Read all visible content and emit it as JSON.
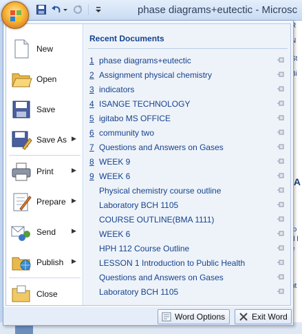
{
  "window": {
    "title": "phase diagrams+eutectic - Microsc"
  },
  "commands": [
    {
      "label": "New",
      "icon": "new-document-icon",
      "arrow": ""
    },
    {
      "label": "Open",
      "icon": "open-folder-icon",
      "arrow": ""
    },
    {
      "label": "Save",
      "icon": "save-disk-icon",
      "arrow": ""
    },
    {
      "label": "Save As",
      "icon": "save-as-icon",
      "arrow": "▶"
    },
    {
      "label": "Print",
      "icon": "printer-icon",
      "arrow": "▶"
    },
    {
      "label": "Prepare",
      "icon": "prepare-icon",
      "arrow": "▶"
    },
    {
      "label": "Send",
      "icon": "send-icon",
      "arrow": "▶"
    },
    {
      "label": "Publish",
      "icon": "publish-icon",
      "arrow": "▶"
    },
    {
      "label": "Close",
      "icon": "close-folder-icon",
      "arrow": ""
    }
  ],
  "recent": {
    "title": "Recent Documents",
    "items": [
      {
        "num": "1",
        "name": "phase diagrams+eutectic"
      },
      {
        "num": "2",
        "name": "Assignment physical chemistry"
      },
      {
        "num": "3",
        "name": "indicators"
      },
      {
        "num": "4",
        "name": "ISANGE TECHNOLOGY"
      },
      {
        "num": "5",
        "name": "igitabo MS OFFICE"
      },
      {
        "num": "6",
        "name": "community two"
      },
      {
        "num": "7",
        "name": "Questions and Answers on Gases"
      },
      {
        "num": "8",
        "name": "WEEK 9"
      },
      {
        "num": "9",
        "name": "WEEK 6"
      },
      {
        "num": "",
        "name": "Physical chemistry course outline"
      },
      {
        "num": "",
        "name": "Laboratory BCH 1105"
      },
      {
        "num": "",
        "name": "COURSE OUTLINE(BMA 1111)"
      },
      {
        "num": "",
        "name": "WEEK 6"
      },
      {
        "num": "",
        "name": "HPH 112 Course Outline"
      },
      {
        "num": "",
        "name": "LESSON 1 Introduction to Public Health"
      },
      {
        "num": "",
        "name": "Questions and Answers on Gases"
      },
      {
        "num": "",
        "name": "Laboratory BCH 1105"
      }
    ]
  },
  "footer": {
    "options_label": "Word Options",
    "exit_label": "Exit Word"
  },
  "peek_text": [
    "R",
    "N",
    "St",
    "Bi",
    "IA",
    "fo",
    "d l",
    "e",
    "ut"
  ]
}
